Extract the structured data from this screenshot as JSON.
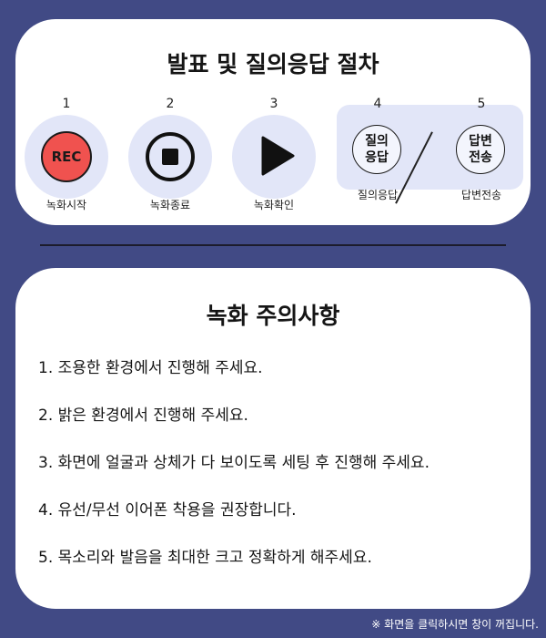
{
  "procedure": {
    "title": "발표 및 질의응답 절차",
    "steps": [
      {
        "num": "1",
        "label": "녹화시작",
        "icon": "rec-icon",
        "icon_text": "REC"
      },
      {
        "num": "2",
        "label": "녹화종료",
        "icon": "stop-icon"
      },
      {
        "num": "3",
        "label": "녹화확인",
        "icon": "play-icon"
      },
      {
        "num": "4",
        "label": "질의응답",
        "icon_line1": "질의",
        "icon_line2": "응답"
      },
      {
        "num": "5",
        "label": "답변전송",
        "icon_line1": "답변",
        "icon_line2": "전송"
      }
    ]
  },
  "cautions": {
    "title": "녹화 주의사항",
    "items": [
      "1. 조용한 환경에서 진행해 주세요.",
      "2. 밝은 환경에서 진행해 주세요.",
      "3. 화면에 얼굴과 상체가 다 보이도록 세팅 후 진행해 주세요.",
      "4. 유선/무선 이어폰 착용을 권장합니다.",
      "5. 목소리와 발음을 최대한 크고 정확하게 해주세요."
    ]
  },
  "footer": "※ 화면을 클릭하시면 창이 꺼집니다.",
  "colors": {
    "background": "#414a85",
    "card": "#ffffff",
    "circle": "#e2e6f8",
    "rec": "#f0524f"
  }
}
